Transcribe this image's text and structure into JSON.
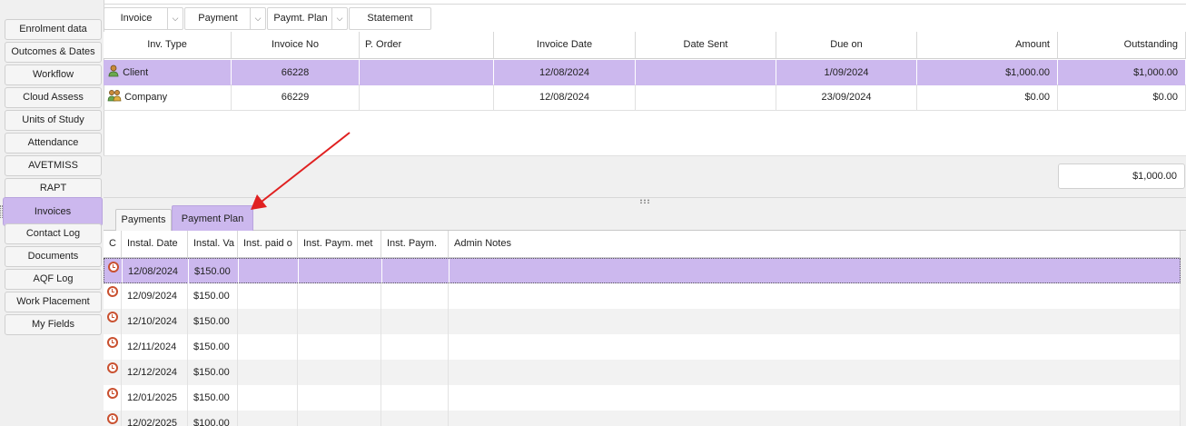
{
  "sidebar": {
    "items": [
      {
        "label": "Enrolment data"
      },
      {
        "label": "Outcomes & Dates"
      },
      {
        "label": "Workflow"
      },
      {
        "label": "Cloud Assess"
      },
      {
        "label": "Units of Study"
      },
      {
        "label": "Attendance"
      },
      {
        "label": "AVETMISS"
      },
      {
        "label": "RAPT"
      },
      {
        "label": "Invoices"
      },
      {
        "label": "Contact Log"
      },
      {
        "label": "Documents"
      },
      {
        "label": "AQF Log"
      },
      {
        "label": "Work Placement"
      },
      {
        "label": "My Fields"
      }
    ],
    "active_index": 8
  },
  "toolbar": {
    "invoice_label": "Invoice",
    "payment_label": "Payment",
    "paymt_plan_label": "Paymt. Plan",
    "statement_label": "Statement"
  },
  "invoices": {
    "columns": [
      "Inv. Type",
      "Invoice No",
      "P. Order",
      "Invoice Date",
      "Date Sent",
      "Due on",
      "Amount",
      "Outstanding"
    ],
    "rows": [
      {
        "inv_type": "Client",
        "invoice_no": "66228",
        "p_order": "",
        "invoice_date": "12/08/2024",
        "date_sent": "",
        "due_on": "1/09/2024",
        "amount": "$1,000.00",
        "outstanding": "$1,000.00",
        "icon": "person-icon",
        "selected": true
      },
      {
        "inv_type": "Company",
        "invoice_no": "66229",
        "p_order": "",
        "invoice_date": "12/08/2024",
        "date_sent": "",
        "due_on": "23/09/2024",
        "amount": "$0.00",
        "outstanding": "$0.00",
        "icon": "group-icon",
        "selected": false
      }
    ],
    "total_outstanding": "$1,000.00"
  },
  "tabs": {
    "payments_label": "Payments",
    "payment_plan_label": "Payment Plan",
    "active": "payment_plan"
  },
  "plan": {
    "columns": [
      "C",
      "Instal. Date",
      "Instal. Va",
      "Inst. paid o",
      "Inst. Paym. met",
      "Inst. Paym.",
      "Admin Notes"
    ],
    "rows": [
      {
        "date": "12/08/2024",
        "value": "$150.00"
      },
      {
        "date": "12/09/2024",
        "value": "$150.00"
      },
      {
        "date": "12/10/2024",
        "value": "$150.00"
      },
      {
        "date": "12/11/2024",
        "value": "$150.00"
      },
      {
        "date": "12/12/2024",
        "value": "$150.00"
      },
      {
        "date": "12/01/2025",
        "value": "$150.00"
      },
      {
        "date": "12/02/2025",
        "value": "$100.00"
      }
    ],
    "row_icon": "clock-icon"
  },
  "colors": {
    "selection": "#ccb8ee",
    "annotation_arrow": "#e02020",
    "clock_icon": "#c9502f"
  }
}
